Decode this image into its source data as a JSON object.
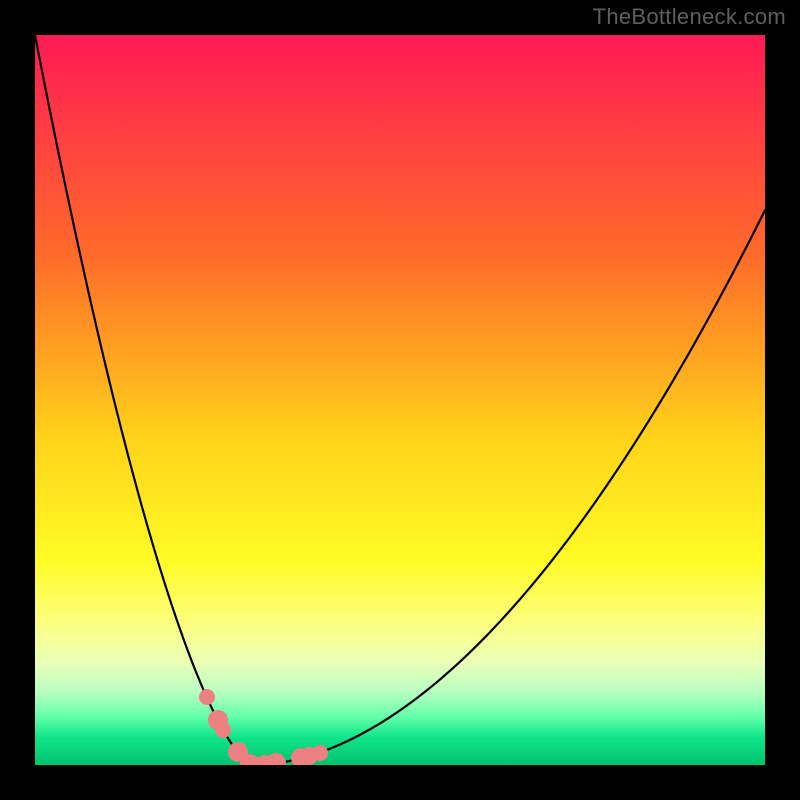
{
  "watermark": "TheBottleneck.com",
  "chart_data": {
    "type": "line",
    "title": "",
    "xlabel": "",
    "ylabel": "",
    "xlim": [
      0,
      100
    ],
    "ylim": [
      0,
      100
    ],
    "x_min_point": 30,
    "gradient_stops": [
      {
        "offset": 0,
        "color": "#ff1a55"
      },
      {
        "offset": 0.3,
        "color": "#ff6a2a"
      },
      {
        "offset": 0.55,
        "color": "#ffd21a"
      },
      {
        "offset": 0.72,
        "color": "#fffb25"
      },
      {
        "offset": 0.8,
        "color": "#fdff7a"
      },
      {
        "offset": 0.86,
        "color": "#eaffb8"
      },
      {
        "offset": 0.9,
        "color": "#b8ffc1"
      },
      {
        "offset": 0.935,
        "color": "#5fffa9"
      },
      {
        "offset": 0.962,
        "color": "#10e58a"
      },
      {
        "offset": 1.0,
        "color": "#00c36d"
      }
    ],
    "curve": {
      "color": "#000000",
      "width": 2.2,
      "segments_per_branch": 160
    },
    "markers": {
      "color": "#ed8080",
      "points": [
        {
          "x": 23.5,
          "r": 8
        },
        {
          "x": 25.0,
          "r": 10
        },
        {
          "x": 25.8,
          "r": 8
        },
        {
          "x": 27.8,
          "r": 10
        },
        {
          "x": 29.5,
          "r": 10
        },
        {
          "x": 31.5,
          "r": 10
        },
        {
          "x": 33.0,
          "r": 10
        },
        {
          "x": 36.5,
          "r": 10
        },
        {
          "x": 37.5,
          "r": 9
        },
        {
          "x": 39.0,
          "r": 8
        }
      ]
    }
  }
}
